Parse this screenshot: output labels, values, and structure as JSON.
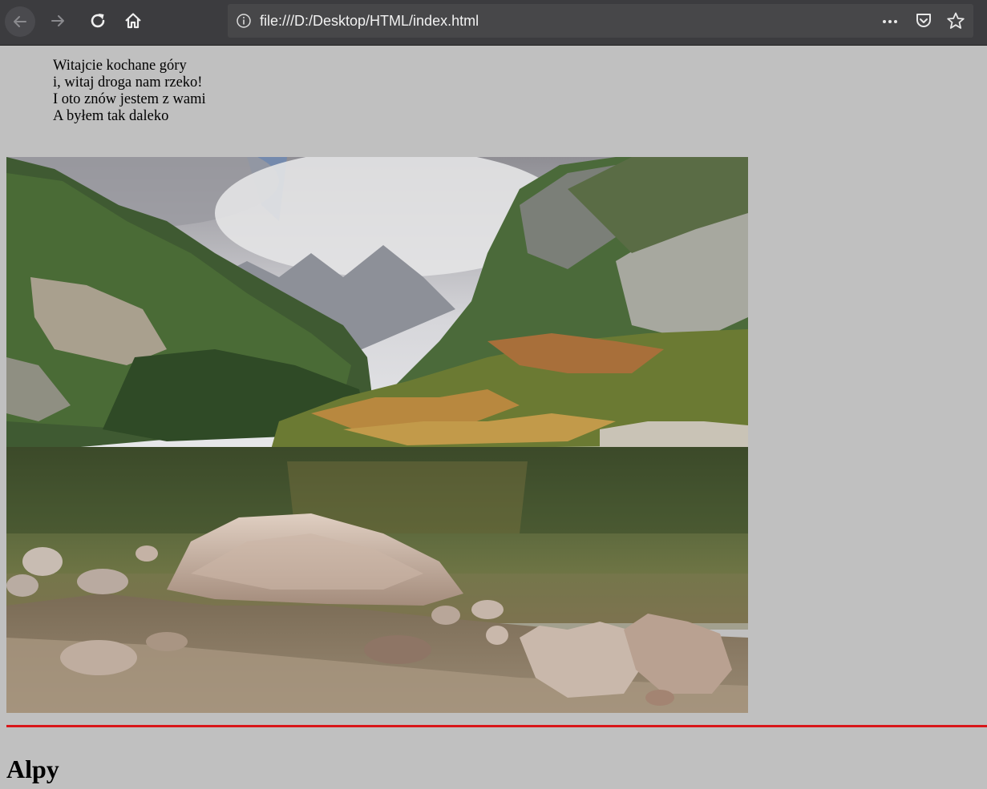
{
  "browser": {
    "url": "file:///D:/Desktop/HTML/index.html",
    "more_icon": "ellipsis-icon",
    "pocket_icon": "pocket-icon",
    "bookmark_icon": "star-icon"
  },
  "poem": {
    "lines": [
      "Witajcie kochane góry",
      "i, witaj droga nam rzeko!",
      "I oto znów jestem z wami",
      "A byłem tak daleko"
    ]
  },
  "image": {
    "subject": "mountain lake landscape"
  },
  "divider_color": "#d9161a",
  "heading": "Alpy"
}
